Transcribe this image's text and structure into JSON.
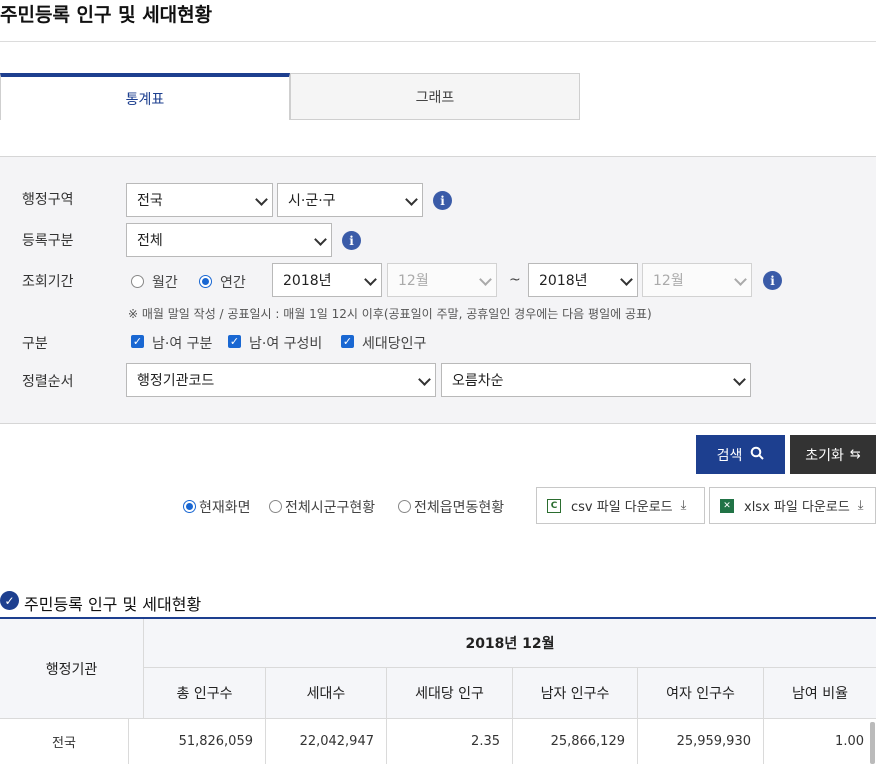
{
  "page_title": "주민등록 인구 및 세대현황",
  "tabs": [
    {
      "label": "통계표",
      "active": true
    },
    {
      "label": "그래프",
      "active": false
    }
  ],
  "filters": {
    "region": {
      "label": "행정구역",
      "sido": "전국",
      "sigungu": "시·군·구"
    },
    "reg_type": {
      "label": "등록구분",
      "value": "전체"
    },
    "period": {
      "label": "조회기간",
      "monthly_label": "월간",
      "yearly_label": "연간",
      "selected": "연간",
      "start_year": "2018년",
      "start_month": "12월",
      "separator": "~",
      "end_year": "2018년",
      "end_month": "12월",
      "note": "※ 매월 말일 작성 / 공표일시 : 매월 1일 12시 이후(공표일이 주말, 공휴일인 경우에는 다음 평일에 공표)"
    },
    "category": {
      "label": "구분",
      "options": [
        "남·여 구분",
        "남·여 구성비",
        "세대당인구"
      ]
    },
    "sort": {
      "label": "정렬순서",
      "field": "행정기관코드",
      "order": "오름차순"
    }
  },
  "buttons": {
    "search": "검색",
    "reset": "초기화"
  },
  "scope": {
    "options": [
      "현재화면",
      "전체시군구현황",
      "전체읍면동현황"
    ],
    "selected": "현재화면"
  },
  "downloads": {
    "csv": "csv 파일 다운로드",
    "xlsx": "xlsx 파일 다운로드",
    "csv_icon": "C"
  },
  "section_title": "주민등록 인구 및 세대현황",
  "table": {
    "org_header": "행정기관",
    "period_header": "2018년 12월",
    "columns": [
      "총 인구수",
      "세대수",
      "세대당 인구",
      "남자 인구수",
      "여자 인구수",
      "남여 비율"
    ],
    "rows": [
      {
        "org": "전국",
        "values": [
          "51,826,059",
          "22,042,947",
          "2.35",
          "25,866,129",
          "25,959,930",
          "1.00"
        ]
      }
    ]
  },
  "colors": {
    "primary": "#1d3f8f",
    "radio_check": "#1967d2",
    "info": "#3a5ba8"
  }
}
